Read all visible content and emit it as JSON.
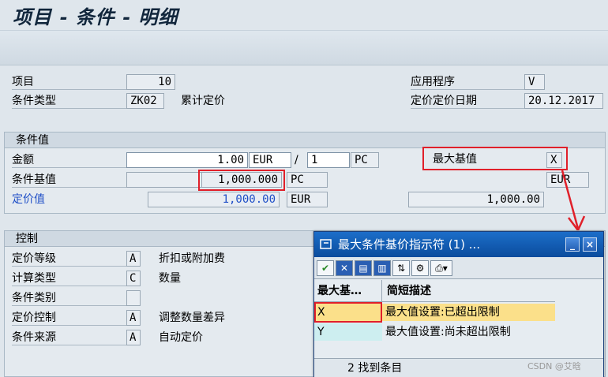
{
  "header": {
    "title": "项目 - 条件 - 明细"
  },
  "top": {
    "item_label": "项目",
    "item_value": "10",
    "cond_type_label": "条件类型",
    "cond_type_value": "ZK02",
    "cond_type_desc": "累计定价",
    "app_label": "应用程序",
    "app_value": "V",
    "price_date_label": "定价定价日期",
    "price_date_value": "20.12.2017"
  },
  "cond_values": {
    "section_title": "条件值",
    "amount_label": "金额",
    "amount_value": "1.00",
    "amount_currency": "EUR",
    "amount_slash": "/",
    "per_value": "1",
    "per_unit": "PC",
    "max_base_label": "最大基值",
    "max_base_value": "X",
    "base_label": "条件基值",
    "base_value": "1,000.000",
    "base_unit": "PC",
    "base_currency2": "EUR",
    "pricing_value_label": "定价值",
    "pricing_value": "1,000.00",
    "pricing_currency": "EUR",
    "right_total": "1,000.00"
  },
  "control": {
    "section_title": "控制",
    "rows": [
      {
        "label": "定价等级",
        "code": "A",
        "desc": "折扣或附加费"
      },
      {
        "label": "计算类型",
        "code": "C",
        "desc": "数量"
      },
      {
        "label": "条件类别",
        "code": "",
        "desc": ""
      },
      {
        "label": "定价控制",
        "code": "A",
        "desc": "调整数量差异"
      },
      {
        "label": "条件来源",
        "code": "A",
        "desc": "自动定价"
      }
    ]
  },
  "popup": {
    "title": "最大条件基价指示符 (1)  ...",
    "col1": "最大基…",
    "col2": "简短描述",
    "rows": [
      {
        "code": "X",
        "desc": "最大值设置:已超出限制"
      },
      {
        "code": "Y",
        "desc": "最大值设置:尚未超出限制"
      }
    ],
    "status": "2 找到条目"
  },
  "watermark": "CSDN @艾晗",
  "colors": {
    "accent_red": "#e0202a",
    "popup_title_blue": "#0b4c9d",
    "selected_row": "#fbe08a",
    "row2": "#cdeef0"
  }
}
